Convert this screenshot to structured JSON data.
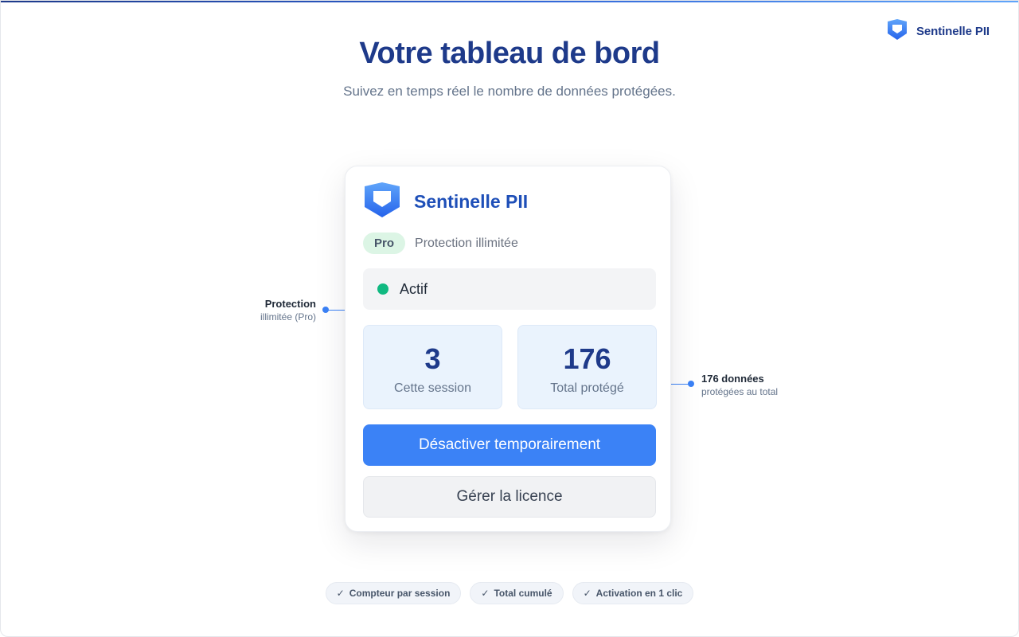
{
  "brand": {
    "name": "Sentinelle PII",
    "icon": "shield-icon"
  },
  "hero": {
    "title": "Votre tableau de bord",
    "subtitle": "Suivez en temps réel le nombre de données protégées."
  },
  "popup": {
    "title": "Sentinelle PII",
    "plan_badge": "Pro",
    "plan_text": "Protection illimitée",
    "status": {
      "label": "Actif",
      "color": "#10b981"
    },
    "stats": [
      {
        "value": "3",
        "label": "Cette session"
      },
      {
        "value": "176",
        "label": "Total protégé"
      }
    ],
    "primary_button": "Désactiver temporairement",
    "secondary_button": "Gérer la licence"
  },
  "callouts": {
    "left": {
      "title": "Protection",
      "subtitle": "illimitée (Pro)"
    },
    "right": {
      "title": "176 données",
      "subtitle": "protégées au total"
    }
  },
  "features": [
    {
      "check": "✓",
      "label": "Compteur par session"
    },
    {
      "check": "✓",
      "label": "Total cumulé"
    },
    {
      "check": "✓",
      "label": "Activation en 1 clic"
    }
  ],
  "colors": {
    "accent": "#3b82f6",
    "title": "#1e3a8a",
    "status_active": "#10b981",
    "stat_bg": "#eaf3fd"
  }
}
